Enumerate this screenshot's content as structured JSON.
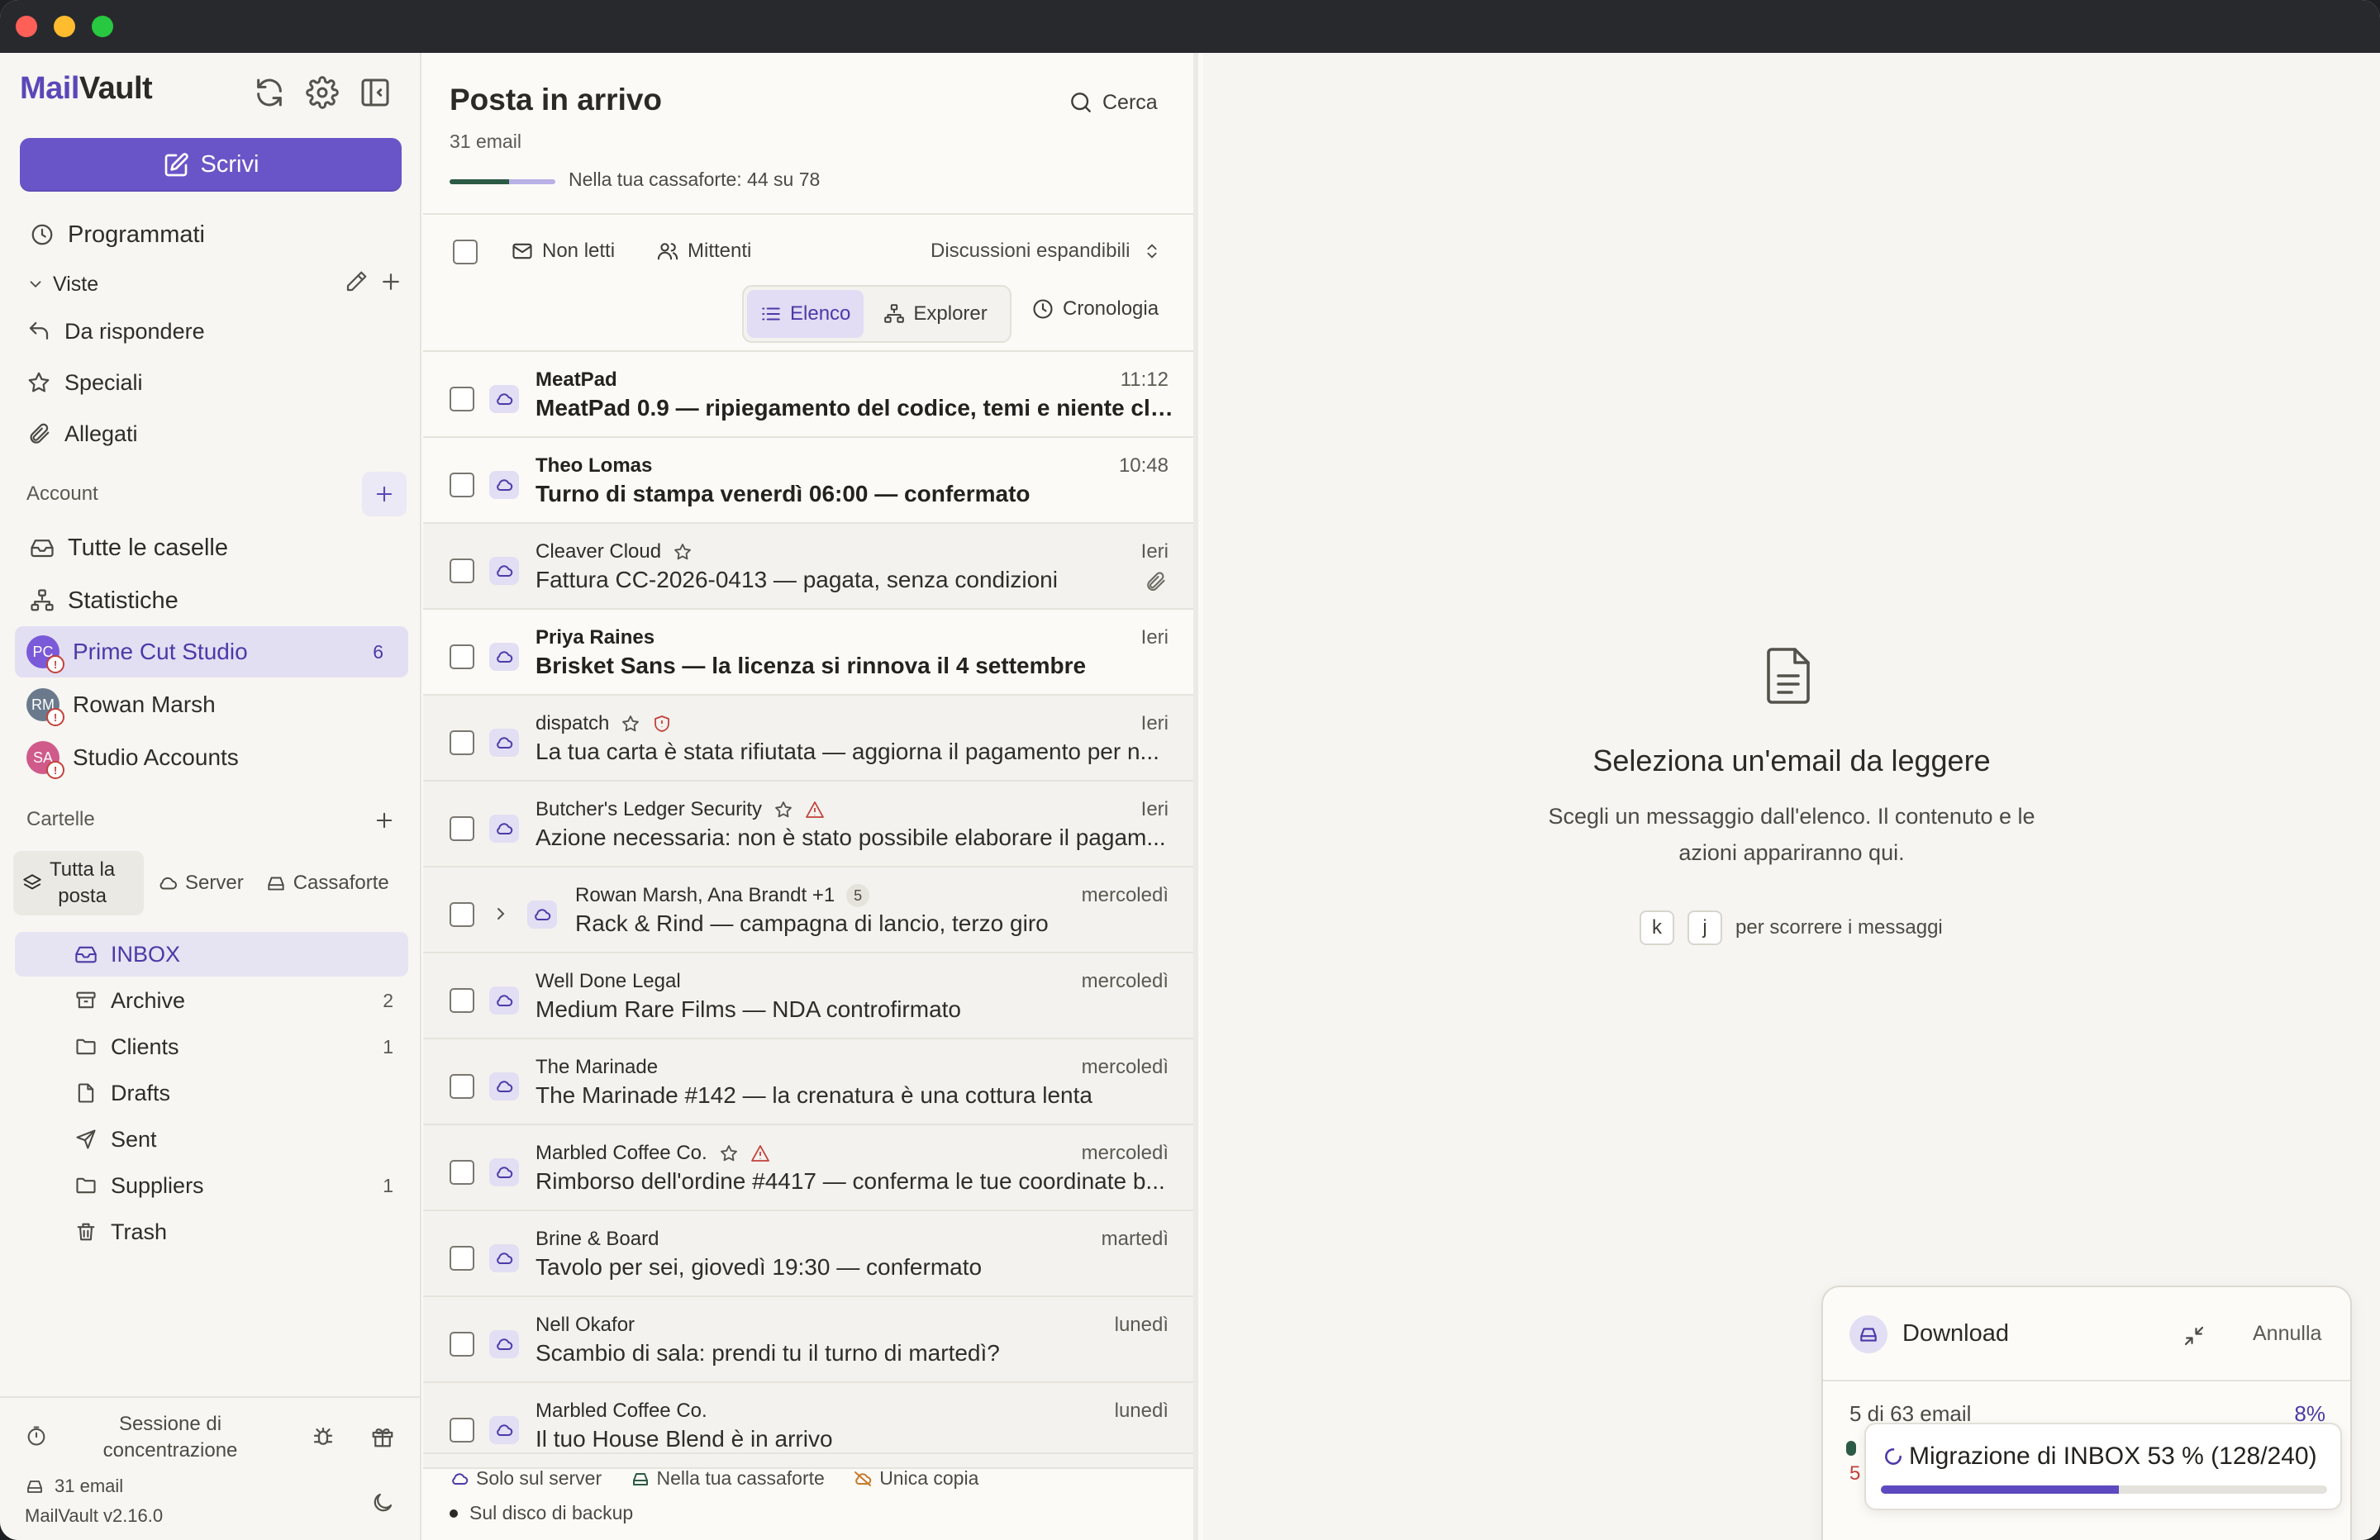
{
  "app": {
    "brand_part1": "Mail",
    "brand_part2": "Vault",
    "accent_color": "#6a55c8"
  },
  "sidebar": {
    "compose_label": "Scrivi",
    "scheduled_label": "Programmati",
    "views_label": "Viste",
    "views": [
      {
        "label": "Da rispondere",
        "icon": "reply-icon"
      },
      {
        "label": "Speciali",
        "icon": "star-icon"
      },
      {
        "label": "Allegati",
        "icon": "paperclip-icon"
      }
    ],
    "account_label": "Account",
    "account_links": [
      {
        "label": "Tutte le caselle",
        "icon": "inbox-icon"
      },
      {
        "label": "Statistiche",
        "icon": "hierarchy-icon"
      }
    ],
    "accounts": [
      {
        "name": "Prime Cut Studio",
        "initials": "PC",
        "count": "6",
        "color": "#7a5ad8"
      },
      {
        "name": "Rowan Marsh",
        "initials": "RM",
        "count": "",
        "color": "#6a7a8c"
      },
      {
        "name": "Studio Accounts",
        "initials": "SA",
        "count": "",
        "color": "#d05a8a"
      }
    ],
    "folders_label": "Cartelle",
    "folder_filter": {
      "all": "Tutta la posta",
      "all_line1": "Tutta la",
      "all_line2": "posta",
      "server": "Server",
      "vault": "Cassaforte"
    },
    "folders": [
      {
        "name": "INBOX",
        "count": "",
        "icon": "inbox-icon"
      },
      {
        "name": "Archive",
        "count": "2",
        "icon": "archive-icon"
      },
      {
        "name": "Clients",
        "count": "1",
        "icon": "folder-icon"
      },
      {
        "name": "Drafts",
        "count": "",
        "icon": "file-icon"
      },
      {
        "name": "Sent",
        "count": "",
        "icon": "send-icon"
      },
      {
        "name": "Suppliers",
        "count": "1",
        "icon": "folder-icon"
      },
      {
        "name": "Trash",
        "count": "",
        "icon": "trash-icon"
      }
    ],
    "footer": {
      "focus_line1": "Sessione di",
      "focus_line2": "concentrazione",
      "email_count": "31 email",
      "version": "MailVault v2.16.0"
    }
  },
  "list": {
    "title": "Posta in arrivo",
    "subtitle": "31 email",
    "vault_progress": 0.56,
    "vault_text": "Nella tua cassaforte: 44 su 78",
    "search_label": "Cerca",
    "filters": {
      "unread": "Non letti",
      "senders": "Mittenti",
      "threads": "Discussioni espandibili"
    },
    "views": {
      "list": "Elenco",
      "explorer": "Explorer",
      "history": "Cronologia"
    },
    "messages": [
      {
        "from": "MeatPad",
        "subject": "MeatPad 0.9 — ripiegamento del codice, temi e niente clo...",
        "time": "11:12",
        "unread": true
      },
      {
        "from": "Theo Lomas",
        "subject": "Turno di stampa venerdì 06:00 — confermato",
        "time": "10:48",
        "unread": true
      },
      {
        "from": "Cleaver Cloud",
        "subject": "Fattura CC-2026-0413 — pagata, senza condizioni",
        "time": "Ieri",
        "unread": false
      },
      {
        "from": "Priya Raines",
        "subject": "Brisket Sans — la licenza si rinnova il 4 settembre",
        "time": "Ieri",
        "unread": true
      },
      {
        "from": "dispatch",
        "subject": "La tua carta è stata rifiutata — aggiorna il pagamento per n...",
        "time": "Ieri",
        "unread": false
      },
      {
        "from": "Butcher's Ledger Security",
        "subject": "Azione necessaria: non è stato possibile elaborare il pagam...",
        "time": "Ieri",
        "unread": false
      },
      {
        "from": "Rowan Marsh, Ana Brandt +1",
        "subject": "Rack & Rind — campagna di lancio, terzo giro",
        "time": "mercoledì",
        "unread": false,
        "thread_count": "5"
      },
      {
        "from": "Well Done Legal",
        "subject": "Medium Rare Films — NDA controfirmato",
        "time": "mercoledì",
        "unread": false
      },
      {
        "from": "The Marinade",
        "subject": "The Marinade #142 — la crenatura è una cottura lenta",
        "time": "mercoledì",
        "unread": false
      },
      {
        "from": "Marbled Coffee Co.",
        "subject": "Rimborso dell'ordine #4417 — conferma le tue coordinate b...",
        "time": "mercoledì",
        "unread": false
      },
      {
        "from": "Brine & Board",
        "subject": "Tavolo per sei, giovedì 19:30 — confermato",
        "time": "martedì",
        "unread": false
      },
      {
        "from": "Nell Okafor",
        "subject": "Scambio di sala: prendi tu il turno di martedì?",
        "time": "lunedì",
        "unread": false
      },
      {
        "from": "Marbled Coffee Co.",
        "subject": "Il tuo House Blend è in arrivo",
        "time": "lunedì",
        "unread": false
      }
    ],
    "legend": {
      "server_only": "Solo sul server",
      "in_vault": "Nella tua cassaforte",
      "single_copy": "Unica copia",
      "backup_disk": "Sul disco di backup"
    }
  },
  "reader": {
    "empty_title": "Seleziona un'email da leggere",
    "empty_text": "Scegli un messaggio dall'elenco. Il contenuto e le azioni appariranno qui.",
    "key_k": "k",
    "key_j": "j",
    "keys_hint": "per scorrere i messaggi"
  },
  "download": {
    "title": "Download",
    "cancel": "Annulla",
    "status": "5 di 63 email",
    "percent": "8%",
    "under_text": "5",
    "migration_text": "Migrazione di INBOX 53 % (128/240)",
    "migration_progress": 0.533
  }
}
